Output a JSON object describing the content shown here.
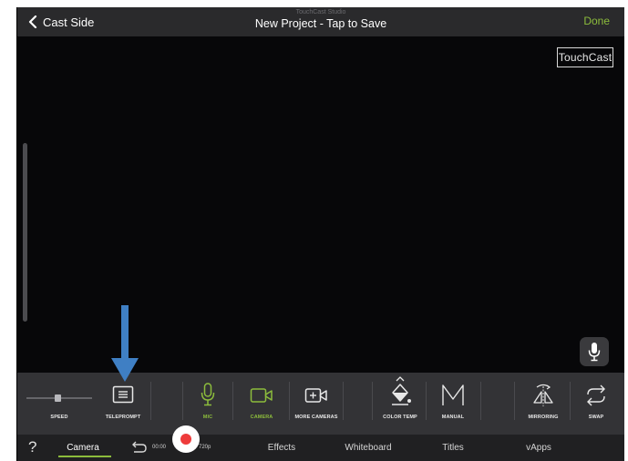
{
  "topbar": {
    "back_label": "Cast Side",
    "studio_label": "TouchCast Studio",
    "project_title": "New Project - Tap to Save",
    "done_label": "Done"
  },
  "preview": {
    "watermark": "TouchCast"
  },
  "toolbar": {
    "speed_label": "SPEED",
    "teleprompt_label": "TELEPROMPT",
    "mic_label": "MIC",
    "camera_label": "CAMERA",
    "more_cameras_label": "MORE CAMERAS",
    "color_temp_label": "COLOR TEMP",
    "manual_label": "MANUAL",
    "mirroring_label": "MIRRORING",
    "swap_label": "SWAP"
  },
  "tabbar": {
    "help": "?",
    "camera": "Camera",
    "timer": "00:00",
    "resolution": "720p",
    "effects": "Effects",
    "whiteboard": "Whiteboard",
    "titles": "Titles",
    "vapps": "vApps"
  },
  "colors": {
    "accent_green": "#8cbc3c",
    "annotation_arrow": "#3f7fc4",
    "record_red": "#ee3b3b"
  },
  "icons": [
    "chevron-left-icon",
    "mic-icon",
    "teleprompt-icon",
    "camera-icon",
    "more-cameras-icon",
    "color-temp-icon",
    "manual-icon",
    "mirroring-icon",
    "swap-icon",
    "undo-icon",
    "record-icon"
  ]
}
